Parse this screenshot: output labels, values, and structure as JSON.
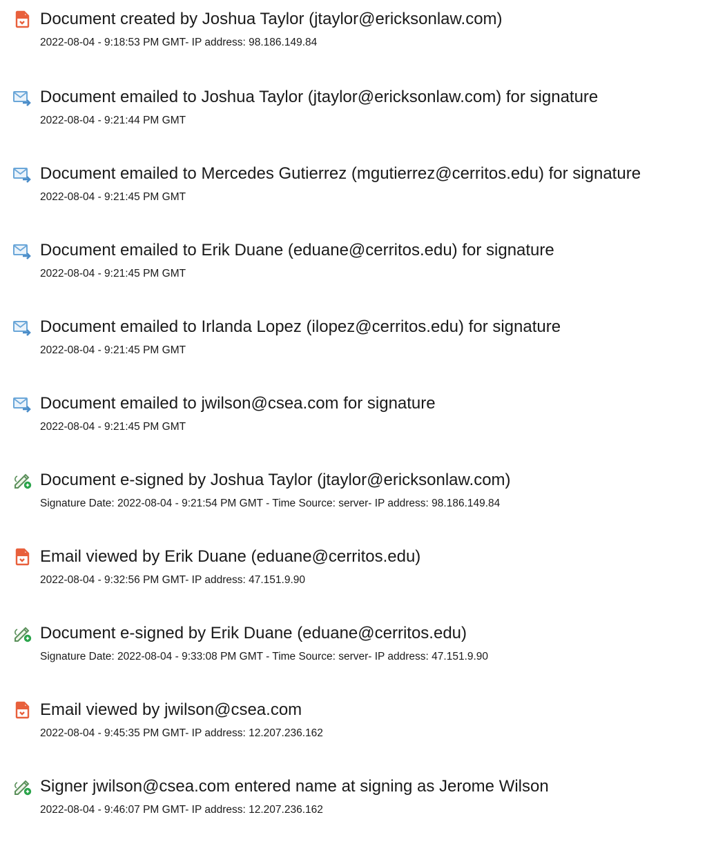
{
  "events": [
    {
      "icon": "document-icon",
      "title": "Document created by Joshua Taylor (jtaylor@ericksonlaw.com)",
      "detail": "2022-08-04 - 9:18:53 PM GMT- IP address: 98.186.149.84"
    },
    {
      "icon": "email-sent-icon",
      "title": "Document emailed to Joshua Taylor (jtaylor@ericksonlaw.com) for signature",
      "detail": "2022-08-04 - 9:21:44 PM GMT"
    },
    {
      "icon": "email-sent-icon",
      "title": "Document emailed to Mercedes Gutierrez (mgutierrez@cerritos.edu) for signature",
      "detail": "2022-08-04 - 9:21:45 PM GMT"
    },
    {
      "icon": "email-sent-icon",
      "title": "Document emailed to Erik Duane (eduane@cerritos.edu) for signature",
      "detail": "2022-08-04 - 9:21:45 PM GMT"
    },
    {
      "icon": "email-sent-icon",
      "title": "Document emailed to Irlanda Lopez (ilopez@cerritos.edu) for signature",
      "detail": "2022-08-04 - 9:21:45 PM GMT"
    },
    {
      "icon": "email-sent-icon",
      "title": "Document emailed to jwilson@csea.com for signature",
      "detail": "2022-08-04 - 9:21:45 PM GMT"
    },
    {
      "icon": "esign-pen-icon",
      "title": "Document e-signed by Joshua Taylor (jtaylor@ericksonlaw.com)",
      "detail": "Signature Date: 2022-08-04 - 9:21:54 PM GMT - Time Source: server- IP address: 98.186.149.84"
    },
    {
      "icon": "document-icon",
      "title": "Email viewed by Erik Duane (eduane@cerritos.edu)",
      "detail": "2022-08-04 - 9:32:56 PM GMT- IP address: 47.151.9.90"
    },
    {
      "icon": "esign-pen-icon",
      "title": "Document e-signed by Erik Duane (eduane@cerritos.edu)",
      "detail": "Signature Date: 2022-08-04 - 9:33:08 PM GMT - Time Source: server- IP address: 47.151.9.90"
    },
    {
      "icon": "document-icon",
      "title": "Email viewed by jwilson@csea.com",
      "detail": "2022-08-04 - 9:45:35 PM GMT- IP address: 12.207.236.162"
    },
    {
      "icon": "esign-pen-icon",
      "title": "Signer jwilson@csea.com entered name at signing as Jerome Wilson",
      "detail": "2022-08-04 - 9:46:07 PM GMT- IP address: 12.207.236.162"
    }
  ],
  "colors": {
    "document_icon": "#e8603c",
    "email_icon": "#6aa6d8",
    "pen_icon": "#5a8f5a",
    "pen_badge": "#2aa44a",
    "text": "#1a1a1a"
  }
}
